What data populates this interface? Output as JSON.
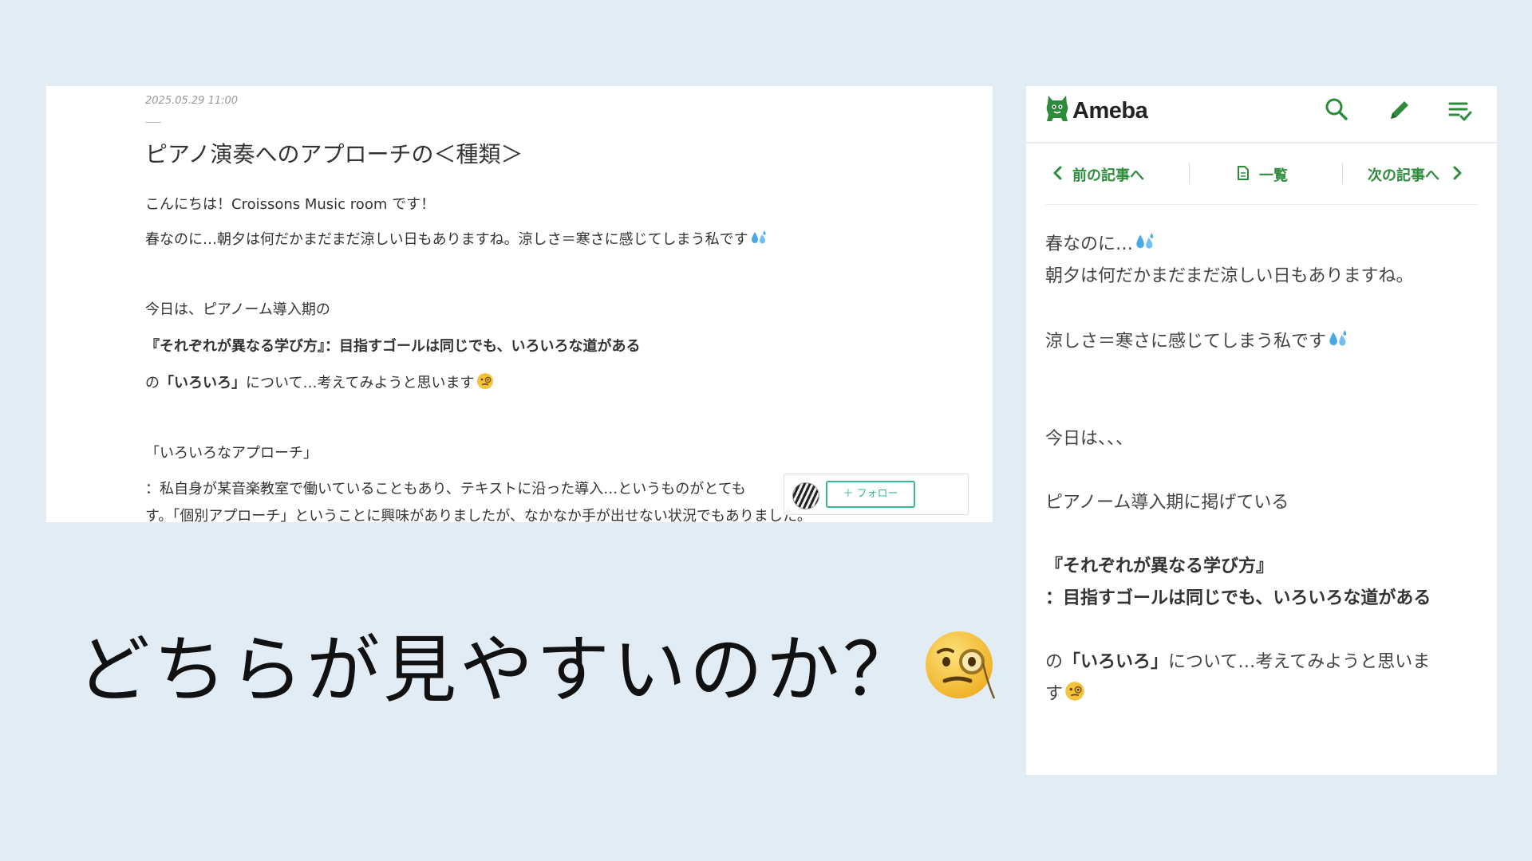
{
  "pc": {
    "date": "2025.05.29 11:00",
    "title": "ピアノ演奏へのアプローチの＜種類＞",
    "greeting": "こんにちは！Croissons Music room です！",
    "line2": "春なのに…朝夕は何だかまだまだ涼しい日もありますね。涼しさ＝寒さに感じてしまう私です",
    "line3": "今日は、ピアノーム導入期の",
    "line4_bold": "『それぞれが異なる学び方』：目指すゴールは同じでも、いろいろな道がある",
    "line5_pre": "の",
    "line5_bold": "「いろいろ」",
    "line5_post": "について…考えてみようと思います",
    "line6": "「いろいろなアプローチ」",
    "line7": "：私自身が某音楽教室で働いていることもあり、テキストに沿った導入…というものがとても",
    "line8": "す。「個別アプローチ」ということに興味がありましたが、なかなか手が出せない状況でもありました。",
    "follow_label": "＋ フォロー"
  },
  "caption": "どちらが見やすいのか？",
  "mobile": {
    "logo": "Ameba",
    "nav_prev": "前の記事へ",
    "nav_list": "一覧",
    "nav_next": "次の記事へ",
    "l1": "春なのに…",
    "l2": "朝夕は何だかまだまだ涼しい日もありますね。",
    "l3": "涼しさ＝寒さに感じてしまう私です",
    "l4": "今日は、、、",
    "l5": "ピアノーム導入期に掲げている",
    "l6": "『それぞれが異なる学び方』",
    "l7": "：目指すゴールは同じでも、いろいろな道がある",
    "l8_pre": "の",
    "l8_bold": "「いろいろ」",
    "l8_post": "について…考えてみようと思いま",
    "l9": "す"
  },
  "colors": {
    "background": "#e1ecf5",
    "ameba_green": "#2d8c3c",
    "follow_green": "#3ab794"
  },
  "icons": [
    "sweat-droplets-icon",
    "monocle-face-icon",
    "ameba-logo-icon",
    "search-icon",
    "pencil-icon",
    "checklist-icon",
    "chevron-left-icon",
    "document-icon",
    "chevron-right-icon"
  ]
}
